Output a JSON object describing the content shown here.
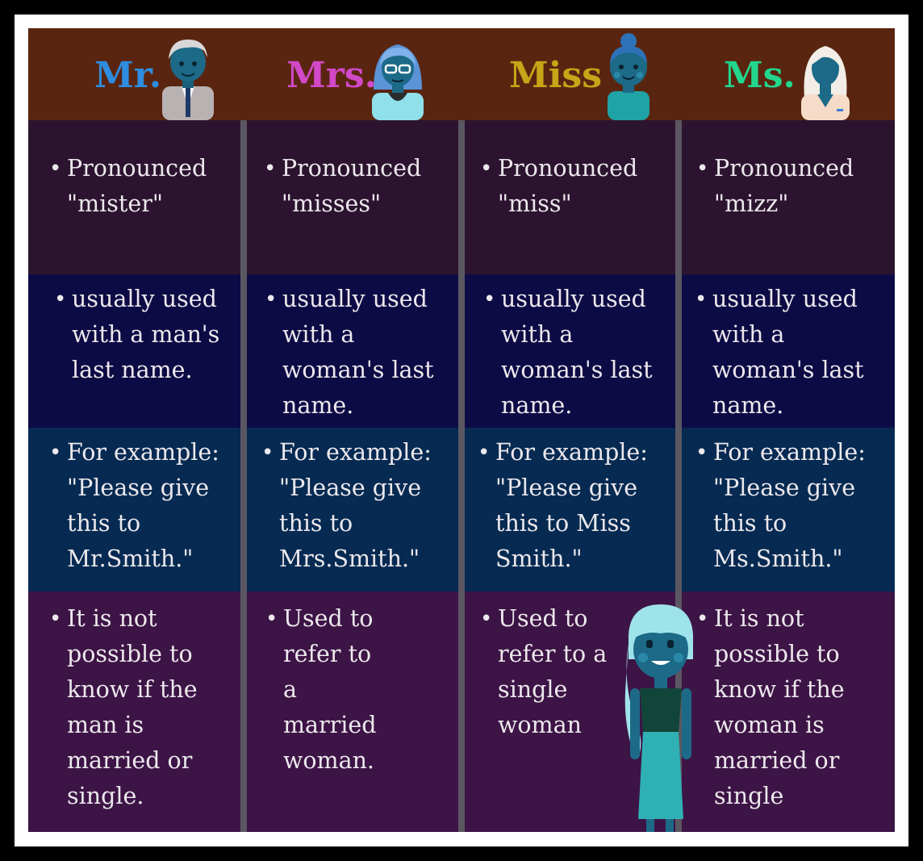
{
  "titles": [
    {
      "text": "Mr.",
      "color": "#2e8de0"
    },
    {
      "text": "Mrs.",
      "color": "#d249c8"
    },
    {
      "text": "Miss",
      "color": "#c8a418"
    },
    {
      "text": "Ms.",
      "color": "#22d68e"
    }
  ],
  "rows": {
    "pronounced": [
      "Pronounced\n\"mister\"",
      "Pronounced\n\"misses\"",
      "Pronounced\n\"miss\"",
      "Pronounced\n\"mizz\""
    ],
    "usage": [
      "usually used\nwith a man's\nlast name.",
      "usually used\nwith a\nwoman's last\nname.",
      "usually used\nwith a\nwoman's last\nname.",
      "usually used\nwith a\nwoman's last\nname."
    ],
    "example": [
      "For example:\n\"Please give\nthis to\nMr.Smith.\"",
      "For example:\n\"Please give\nthis to\nMrs.Smith.\"",
      "For example:\n\"Please give\nthis to Miss\nSmith.\"",
      "For example:\n\"Please give\nthis to\nMs.Smith.\""
    ],
    "marital": [
      "It is not\npossible to\nknow if the\nman is\nmarried or\nsingle.",
      "Used to\nrefer to\na\nmarried\nwoman.",
      "Used to\nrefer to a\nsingle\nwoman",
      "It is not\npossible to\nknow if the\nwoman is\nmarried or\nsingle"
    ]
  },
  "bullet": "•",
  "icons": [
    "man-avatar-icon",
    "woman-glasses-avatar-icon",
    "woman-bun-avatar-icon",
    "woman-blonde-avatar-icon",
    "girl-figure-icon"
  ]
}
